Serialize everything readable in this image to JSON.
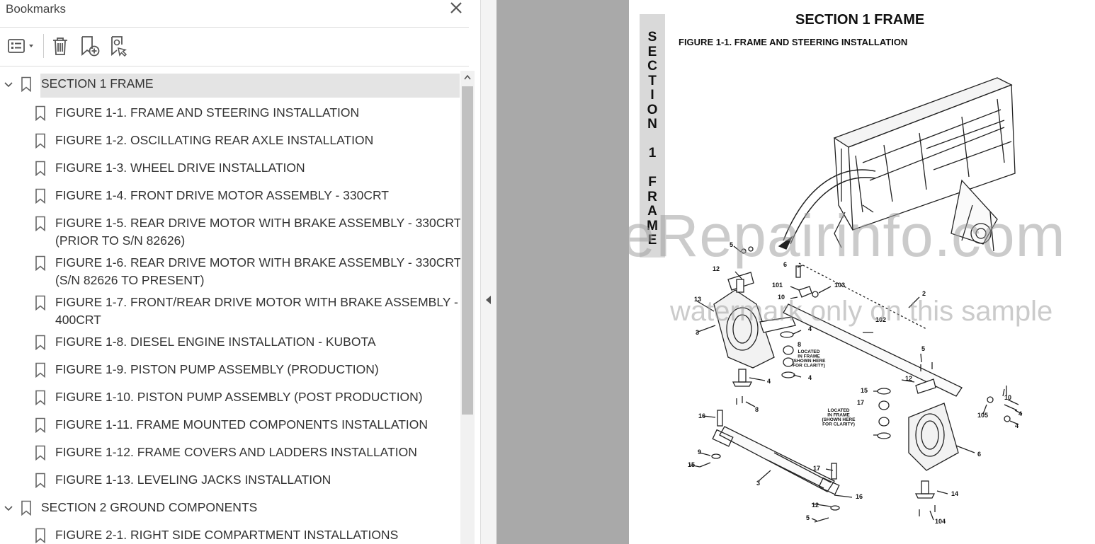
{
  "panel": {
    "title": "Bookmarks",
    "close_icon": "close-icon",
    "toolbar": {
      "options_icon": "options-menu-icon",
      "delete_icon": "trash-icon",
      "add_icon": "add-bookmark-icon",
      "find_icon": "find-bookmark-icon"
    }
  },
  "bookmarks": [
    {
      "level": 0,
      "expanded": true,
      "selected": true,
      "lines": [
        "SECTION 1 FRAME"
      ]
    },
    {
      "level": 1,
      "lines": [
        "FIGURE 1-1. FRAME AND STEERING INSTALLATION"
      ]
    },
    {
      "level": 1,
      "lines": [
        "FIGURE 1-2. OSCILLATING REAR AXLE INSTALLATION"
      ]
    },
    {
      "level": 1,
      "lines": [
        "FIGURE 1-3. WHEEL DRIVE INSTALLATION"
      ]
    },
    {
      "level": 1,
      "lines": [
        "FIGURE 1-4. FRONT DRIVE MOTOR ASSEMBLY - 330CRT"
      ]
    },
    {
      "level": 1,
      "lines": [
        "FIGURE 1-5. REAR DRIVE MOTOR WITH BRAKE ASSEMBLY - 330CRT",
        "(PRIOR TO S/N 82626)"
      ]
    },
    {
      "level": 1,
      "lines": [
        "FIGURE 1-6. REAR DRIVE MOTOR WITH BRAKE ASSEMBLY - 330CRT",
        "(S/N 82626 TO PRESENT)"
      ]
    },
    {
      "level": 1,
      "lines": [
        "FIGURE 1-7. FRONT/REAR DRIVE MOTOR WITH BRAKE ASSEMBLY -",
        "400CRT"
      ]
    },
    {
      "level": 1,
      "lines": [
        "FIGURE 1-8. DIESEL ENGINE INSTALLATION - KUBOTA"
      ]
    },
    {
      "level": 1,
      "lines": [
        "FIGURE 1-9. PISTON PUMP ASSEMBLY (PRODUCTION)"
      ]
    },
    {
      "level": 1,
      "lines": [
        "FIGURE 1-10. PISTON PUMP ASSEMBLY (POST PRODUCTION)"
      ]
    },
    {
      "level": 1,
      "lines": [
        "FIGURE 1-11. FRAME MOUNTED COMPONENTS INSTALLATION"
      ]
    },
    {
      "level": 1,
      "lines": [
        "FIGURE 1-12. FRAME COVERS AND LADDERS INSTALLATION"
      ]
    },
    {
      "level": 1,
      "lines": [
        "FIGURE 1-13. LEVELING JACKS INSTALLATION"
      ]
    },
    {
      "level": 0,
      "expanded": true,
      "lines": [
        "SECTION 2 GROUND COMPONENTS"
      ]
    },
    {
      "level": 1,
      "lines": [
        "FIGURE 2-1. RIGHT SIDE COMPARTMENT INSTALLATIONS"
      ]
    }
  ],
  "document": {
    "section_title": "SECTION 1  FRAME",
    "figure_title": "FIGURE 1-1.    FRAME AND STEERING INSTALLATION",
    "side_tab": [
      "S",
      "E",
      "C",
      "T",
      "I",
      "O",
      "N",
      "",
      "1",
      "",
      "F",
      "R",
      "A",
      "M",
      "E"
    ],
    "watermark_1": "eRepairinfo.com",
    "watermark_2": "watermark only on this sample",
    "callouts": [
      "5",
      "12",
      "6",
      "13",
      "101",
      "10",
      "103",
      "2",
      "3",
      "4",
      "8",
      "102",
      "5",
      "12",
      "4",
      "4",
      "8",
      "15",
      "17",
      "16",
      "9",
      "15",
      "3",
      "17",
      "16",
      "12",
      "5",
      "14",
      "104",
      "6",
      "105",
      "10",
      "4",
      "4"
    ],
    "located_note": [
      "LOCATED",
      "IN FRAME",
      "(SHOWN HERE",
      "FOR CLARITY)"
    ]
  }
}
